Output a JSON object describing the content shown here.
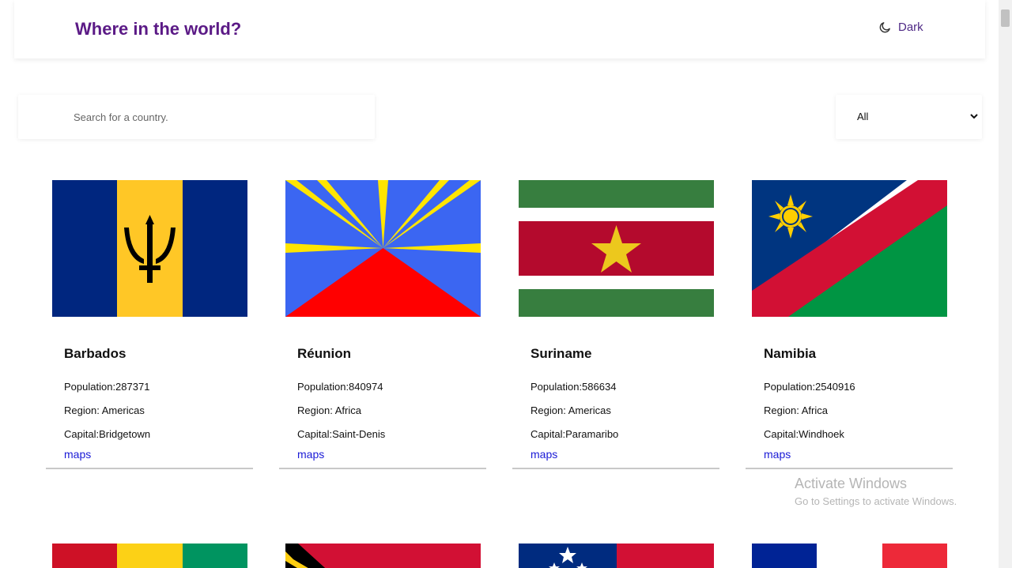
{
  "header": {
    "title": "Where in the world?",
    "mode_label": "Dark",
    "mode_icon": "moon-icon"
  },
  "search": {
    "placeholder": "Search for a country."
  },
  "filter": {
    "selected": "All"
  },
  "countries": [
    {
      "name": "Barbados",
      "population": "Population:287371",
      "region": "Region: Americas",
      "capital": "Capital:Bridgetown",
      "link": "maps"
    },
    {
      "name": "Réunion",
      "population": "Population:840974",
      "region": "Region: Africa",
      "capital": "Capital:Saint-Denis",
      "link": "maps"
    },
    {
      "name": "Suriname",
      "population": "Population:586634",
      "region": "Region: Americas",
      "capital": "Capital:Paramaribo",
      "link": "maps"
    },
    {
      "name": "Namibia",
      "population": "Population:2540916",
      "region": "Region: Africa",
      "capital": "Capital:Windhoek",
      "link": "maps"
    }
  ],
  "watermark": {
    "line1": "Activate Windows",
    "line2": "Go to Settings to activate Windows."
  },
  "colors": {
    "brand": "#5b1a86",
    "link": "#1a1ad6"
  }
}
